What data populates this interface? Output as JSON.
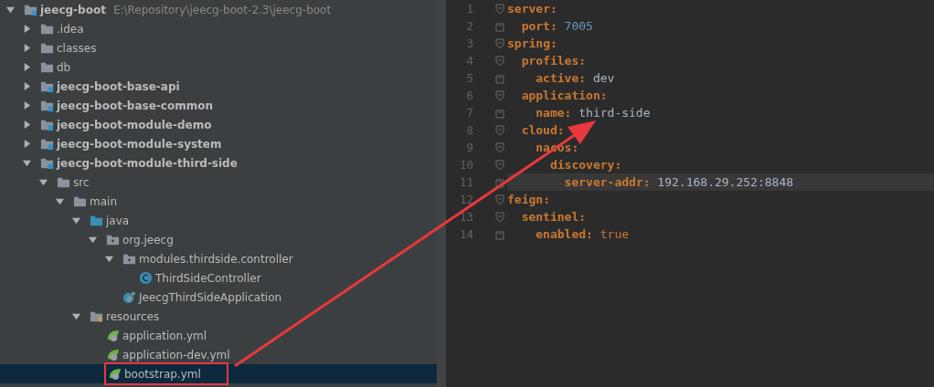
{
  "project_tree": [
    {
      "label": "jeecg-boot",
      "path": "E:\\Repository\\jeecg-boot-2.3\\jeecg-boot",
      "kind": "module",
      "bold": true,
      "expanded": true,
      "selected": false,
      "children": [
        {
          "label": ".idea",
          "kind": "folder",
          "bold": false,
          "expanded": false,
          "selected": false
        },
        {
          "label": "classes",
          "kind": "folder",
          "bold": false,
          "expanded": false,
          "selected": false
        },
        {
          "label": "db",
          "kind": "folder",
          "bold": false,
          "expanded": false,
          "selected": false
        },
        {
          "label": "jeecg-boot-base-api",
          "kind": "module",
          "bold": true,
          "expanded": false,
          "selected": false
        },
        {
          "label": "jeecg-boot-base-common",
          "kind": "module",
          "bold": true,
          "expanded": false,
          "selected": false
        },
        {
          "label": "jeecg-boot-module-demo",
          "kind": "module",
          "bold": true,
          "expanded": false,
          "selected": false
        },
        {
          "label": "jeecg-boot-module-system",
          "kind": "module",
          "bold": true,
          "expanded": false,
          "selected": false
        },
        {
          "label": "jeecg-boot-module-third-side",
          "kind": "module",
          "bold": true,
          "expanded": true,
          "selected": false,
          "children": [
            {
              "label": "src",
              "kind": "folder",
              "bold": false,
              "expanded": true,
              "selected": false,
              "children": [
                {
                  "label": "main",
                  "kind": "folder",
                  "bold": false,
                  "expanded": true,
                  "selected": false,
                  "children": [
                    {
                      "label": "java",
                      "kind": "source-folder",
                      "bold": false,
                      "expanded": true,
                      "selected": false,
                      "children": [
                        {
                          "label": "org.jeecg",
                          "kind": "package",
                          "bold": false,
                          "expanded": true,
                          "selected": false,
                          "children": [
                            {
                              "label": "modules.thirdside.controller",
                              "kind": "package",
                              "bold": false,
                              "expanded": true,
                              "selected": false,
                              "children": [
                                {
                                  "label": "ThirdSideController",
                                  "kind": "class",
                                  "bold": false,
                                  "selected": false
                                }
                              ]
                            },
                            {
                              "label": "JeecgThirdSideApplication",
                              "kind": "spring-app",
                              "bold": false,
                              "selected": false
                            }
                          ]
                        }
                      ]
                    },
                    {
                      "label": "resources",
                      "kind": "resources-folder",
                      "bold": false,
                      "expanded": true,
                      "selected": false,
                      "children": [
                        {
                          "label": "application.yml",
                          "kind": "yaml",
                          "bold": false,
                          "selected": false
                        },
                        {
                          "label": "application-dev.yml",
                          "kind": "yaml",
                          "bold": false,
                          "selected": false
                        },
                        {
                          "label": "bootstrap.yml",
                          "kind": "yaml",
                          "bold": false,
                          "selected": true,
                          "highlighted": true
                        }
                      ]
                    }
                  ]
                }
              ]
            }
          ]
        }
      ]
    }
  ],
  "editor": {
    "lines": [
      {
        "line": "1",
        "key": "server:",
        "current": false,
        "children": [
          {
            "line": "2",
            "key": "port:",
            "value": "7005",
            "color": "#6897bb",
            "current": false
          }
        ]
      },
      {
        "line": "3",
        "key": "spring:",
        "current": false,
        "children": [
          {
            "line": "4",
            "key": "profiles:",
            "current": false,
            "children": [
              {
                "line": "5",
                "key": "active:",
                "value": "dev",
                "color": "#a9b7c6",
                "current": false
              }
            ]
          },
          {
            "line": "6",
            "key": "application:",
            "current": false,
            "children": [
              {
                "line": "7",
                "key": "name:",
                "value": "third-side",
                "color": "#a9b7c6",
                "current": false
              }
            ]
          },
          {
            "line": "8",
            "key": "cloud:",
            "current": false,
            "children": [
              {
                "line": "9",
                "key": "nacos:",
                "current": false,
                "children": [
                  {
                    "line": "10",
                    "key": "discovery:",
                    "current": false,
                    "children": [
                      {
                        "line": "11",
                        "key": "server-addr:",
                        "value": "192.168.29.252:8848",
                        "color": "#a9b7c6",
                        "current": true
                      }
                    ]
                  }
                ]
              }
            ]
          }
        ]
      },
      {
        "line": "12",
        "key": "feign:",
        "current": false,
        "children": [
          {
            "line": "13",
            "key": "sentinel:",
            "current": false,
            "children": [
              {
                "line": "14",
                "key": "enabled:",
                "value": "true",
                "color": "#cc7832",
                "current": false
              }
            ]
          }
        ]
      }
    ]
  }
}
